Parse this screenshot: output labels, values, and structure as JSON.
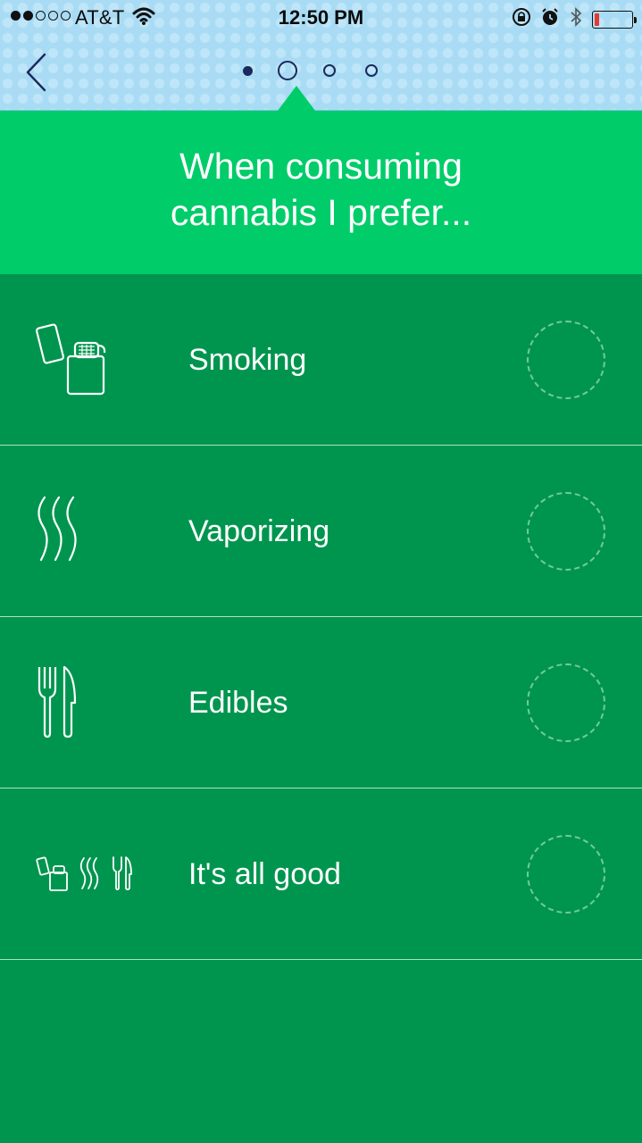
{
  "status_bar": {
    "carrier": "AT&T",
    "time": "12:50 PM",
    "signal_bars": 2,
    "battery_level": 0.12,
    "battery_color": "#e53935"
  },
  "nav": {
    "back_icon": "chevron-left-icon",
    "steps": [
      "completed",
      "current",
      "upcoming",
      "upcoming"
    ]
  },
  "question": {
    "text": "When consuming cannabis I prefer..."
  },
  "options": [
    {
      "label": "Smoking",
      "icon": "lighter-icon",
      "selected": false
    },
    {
      "label": "Vaporizing",
      "icon": "vapor-waves-icon",
      "selected": false
    },
    {
      "label": "Edibles",
      "icon": "fork-knife-icon",
      "selected": false
    },
    {
      "label": "It's all good",
      "icon": "all-methods-icon",
      "selected": false
    }
  ],
  "colors": {
    "header_bg": "#a9dcf4",
    "banner_bg": "#00cc6a",
    "list_bg": "#00954f",
    "accent_dark": "#1a2a5c"
  }
}
